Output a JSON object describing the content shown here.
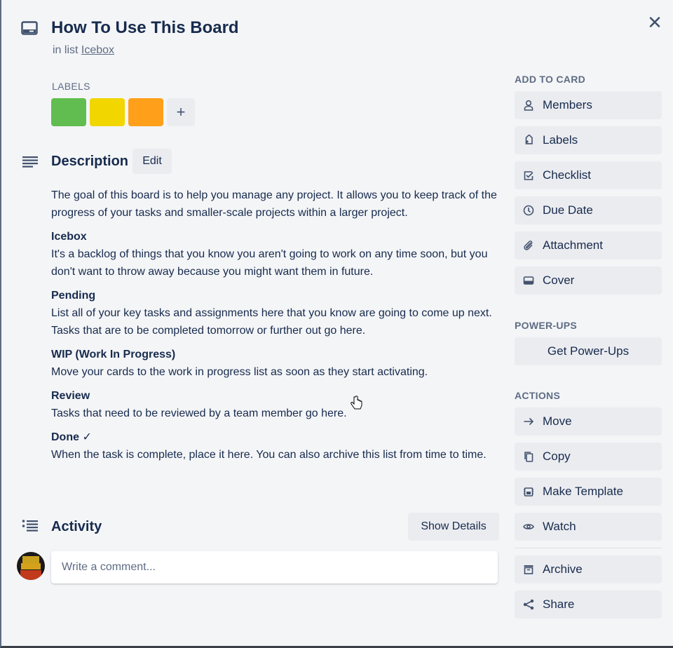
{
  "card": {
    "title": "How To Use This Board",
    "in_list_prefix": "in list",
    "list_name": "Icebox"
  },
  "labels": {
    "heading": "LABELS",
    "chips": [
      {
        "color": "#61bd4f",
        "name": "green"
      },
      {
        "color": "#f2d600",
        "name": "yellow"
      },
      {
        "color": "#ff9f1a",
        "name": "orange"
      }
    ],
    "add_symbol": "+"
  },
  "description": {
    "heading": "Description",
    "edit_label": "Edit",
    "intro": "The goal of this board is to help you manage any project. It allows you to keep track of the progress of your tasks and smaller-scale projects within a larger project.",
    "sections": [
      {
        "title": "Icebox",
        "text": "It's a backlog of things that you know you aren't going to work on any time soon, but you don't want to throw away because you might want them in future."
      },
      {
        "title": "Pending",
        "text": "List all of your key tasks and assignments here that you know are going to come up next. Tasks that are to be completed tomorrow or further out go here."
      },
      {
        "title": "WIP (Work In Progress)",
        "text": "Move your cards to the work in progress list as soon as they start activating."
      },
      {
        "title": "Review",
        "text": "Tasks that need to be reviewed by a team member go here."
      },
      {
        "title": "Done ✓",
        "text": "When the task is complete, place it here. You can also archive this list from time to time."
      }
    ]
  },
  "activity": {
    "heading": "Activity",
    "show_details_label": "Show Details",
    "comment_placeholder": "Write a comment...",
    "comment_value": ""
  },
  "sidebar": {
    "add_to_card": {
      "heading": "ADD TO CARD",
      "items": [
        {
          "label": "Members",
          "icon": "person-icon"
        },
        {
          "label": "Labels",
          "icon": "tag-icon"
        },
        {
          "label": "Checklist",
          "icon": "checkbox-icon"
        },
        {
          "label": "Due Date",
          "icon": "clock-icon"
        },
        {
          "label": "Attachment",
          "icon": "paperclip-icon"
        },
        {
          "label": "Cover",
          "icon": "cover-icon"
        }
      ]
    },
    "power_ups": {
      "heading": "POWER-UPS",
      "button_label": "Get Power-Ups"
    },
    "actions": {
      "heading": "ACTIONS",
      "items": [
        {
          "label": "Move",
          "icon": "arrow-right-icon"
        },
        {
          "label": "Copy",
          "icon": "copy-icon"
        },
        {
          "label": "Make Template",
          "icon": "template-icon"
        },
        {
          "label": "Watch",
          "icon": "eye-icon"
        },
        {
          "label": "Archive",
          "icon": "archive-icon"
        },
        {
          "label": "Share",
          "icon": "share-icon"
        }
      ]
    }
  },
  "close_symbol": "✕"
}
